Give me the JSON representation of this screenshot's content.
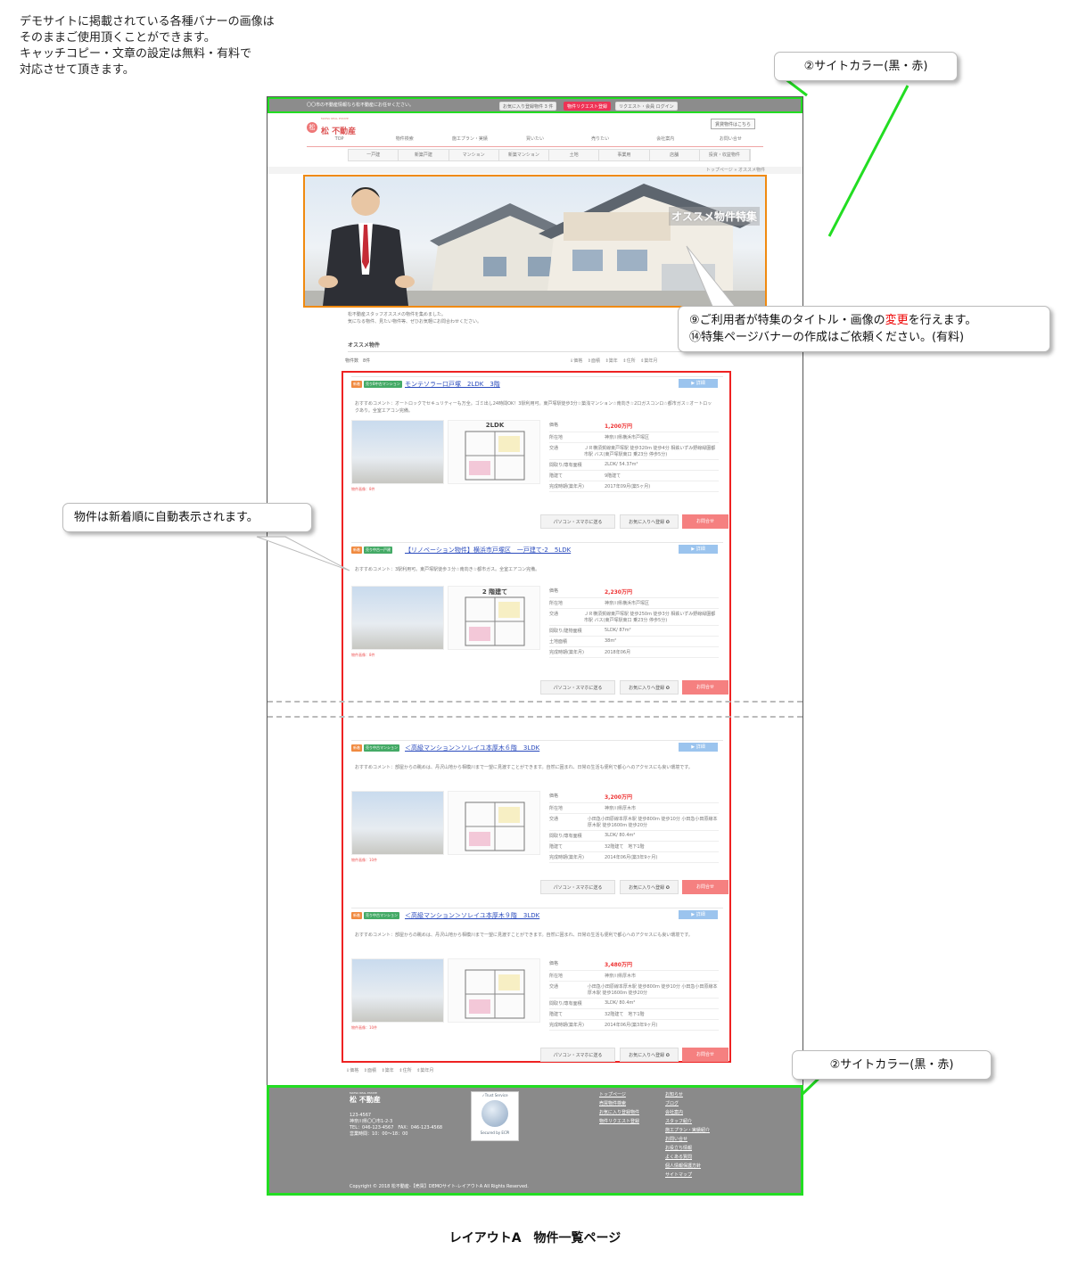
{
  "note_top": "デモサイトに掲載されている各種バナーの画像は\nそのままご使用頂くことができます。\nキャッチコピー・文章の設定は無料・有料で\n対応させて頂きます。",
  "caption": "レイアウトA　物件一覧ページ",
  "callouts": {
    "site_color_top": "②サイトカラー(黒・赤)",
    "site_color_bottom": "②サイトカラー(黒・赤)",
    "feature_line1_pre": "⑨ご利用者が特集のタイトル・画像の",
    "feature_line1_red": "変更",
    "feature_line1_post": "を行えます。",
    "feature_line2": "⑭特集ページバナーの作成はご依頼ください。(有料)",
    "listing_note": "物件は新着順に自動表示されます。"
  },
  "colors": {
    "site_green_frame": "#22dd22",
    "banner_frame": "#f08a10",
    "listing_frame": "#ee2222"
  },
  "site": {
    "tagline": "〇〇市の不動産情報なら松不動産にお任せください。",
    "topbar_buttons": [
      "お気に入り登録物件 3 件",
      "物件リクエスト登録",
      "リクエスト・会員 ログイン"
    ],
    "logo_sub": "MATSU REAL ESTATE",
    "logo_name": "松 不動産",
    "rent_button": "賃貸物件はこちら",
    "global_nav": [
      "TOP",
      "物件検索",
      "施工プラン・実績",
      "買いたい",
      "売りたい",
      "会社案内",
      "お問い合せ"
    ],
    "sub_nav": [
      "一戸建",
      "新築戸建",
      "マンション",
      "新築マンション",
      "土地",
      "事業用",
      "店舗",
      "投資・収益物件"
    ],
    "breadcrumb": "トップページ » オススメ物件",
    "hero_title": "オススメ物件特集",
    "intro": "松不動産スタッフオススメの物件を集めました。\n気になる物件、見たい物件等、ぜひお気軽にお問合わせください。",
    "section_title": "オススメ物件",
    "count": "物件数　8件",
    "sort": [
      "⇓価格",
      "⇕面積",
      "⇕築年",
      "⇕住所",
      "⇕築年月"
    ]
  },
  "listings": [
    {
      "badge_new": "新着",
      "badge_type": "売りB中古マンション",
      "title": "モンテソラー口戸塚　2LDK　3階",
      "detail": "▶ 詳細",
      "comment": "おすすめコメント：オートロックでセキュリティーも万全。ゴミ出し24時間OK！3駅利用可。東戸塚駅徒歩3分☆築浅マンション☆南向き☆2口ガスコンロ☆都市ガス☆オートロックあり。全室エアコン完備。",
      "floor_label": "2LDK",
      "photo_label": "物件画像：8件",
      "specs": [
        [
          "価格",
          "1,200万円"
        ],
        [
          "所在地",
          "神奈川県横浜市戸塚区"
        ],
        [
          "交通",
          "ＪＲ横須賀線東戸塚駅 徒歩320m 徒歩4分 相鉄いずみ野線緑園都市駅 バス(東戸塚駅東口 乗23分 停歩5分)"
        ],
        [
          "間取り/専有面積",
          "2LDK/ 54.37m²"
        ],
        [
          "階建て",
          "9階建て"
        ],
        [
          "完成時期(築年月)",
          "2017年09月(築5ヶ月)"
        ]
      ],
      "actions": [
        "パソコン・スマホに送る",
        "お気に入りへ登録 ✪",
        "お問合せ"
      ]
    },
    {
      "badge_new": "新着",
      "badge_type": "売り中古一戸建",
      "title": "【リノベーション物件】横浜市戸塚区　一戸建て-2　5LDK",
      "detail": "▶ 詳細",
      "comment": "おすすめコメント：3駅利用可。東戸塚駅徒歩３分☆南向き☆都市ガス。全室エアコン完備。",
      "floor_label": "2 階建て",
      "photo_label": "物件画像：8件",
      "specs": [
        [
          "価格",
          "2,230万円"
        ],
        [
          "所在地",
          "神奈川県横浜市戸塚区"
        ],
        [
          "交通",
          "ＪＲ横須賀線東戸塚駅 徒歩250m 徒歩3分 相鉄いずみ野線緑園都市駅 バス(東戸塚駅東口 乗23分 停歩5分)"
        ],
        [
          "間取り/建物面積",
          "5LDK/ 87m²"
        ],
        [
          "土地面積",
          "38m²"
        ],
        [
          "完成時期(築年月)",
          "2018年06月"
        ]
      ],
      "actions": [
        "パソコン・スマホに送る",
        "お気に入りへ登録 ✪",
        "お問合せ"
      ]
    },
    {
      "badge_new": "新着",
      "badge_type": "売り中古マンション",
      "title": "＜高級マンション＞ソレイユ本厚木６階　3LDK",
      "detail": "▶ 詳細",
      "comment": "おすすめコメント：部屋からの眺めは、丹沢山地から相模川まで一望に見渡すことができます。自然に囲まれ、日常の生活も便利で都心へのアクセスにも良い環境です。",
      "floor_label": "",
      "photo_label": "物件画像：10件",
      "specs": [
        [
          "価格",
          "3,200万円"
        ],
        [
          "所在地",
          "神奈川県厚木市"
        ],
        [
          "交通",
          "小田急小田原線本厚木駅 徒歩800m 徒歩10分 小田急小田原線本厚木駅 徒歩1600m 徒歩20分"
        ],
        [
          "間取り/専有面積",
          "3LDK/ 80.4m²"
        ],
        [
          "階建て",
          "32階建て　地下1階"
        ],
        [
          "完成時期(築年月)",
          "2014年06月(築3年9ヶ月)"
        ]
      ],
      "actions": [
        "パソコン・スマホに送る",
        "お気に入りへ登録 ✪",
        "お問合せ"
      ]
    },
    {
      "badge_new": "新着",
      "badge_type": "売り中古マンション",
      "title": "＜高級マンション＞ソレイユ本厚木９階　3LDK",
      "detail": "▶ 詳細",
      "comment": "おすすめコメント：部屋からの眺めは、丹沢山地から相模川まで一望に見渡すことができます。自然に囲まれ、日常の生活も便利で都心へのアクセスにも良い環境です。",
      "floor_label": "",
      "photo_label": "物件画像：10件",
      "specs": [
        [
          "価格",
          "3,480万円"
        ],
        [
          "所在地",
          "神奈川県厚木市"
        ],
        [
          "交通",
          "小田急小田原線本厚木駅 徒歩800m 徒歩10分 小田急小田原線本厚木駅 徒歩1600m 徒歩20分"
        ],
        [
          "間取り/専有面積",
          "3LDK/ 80.4m²"
        ],
        [
          "階建て",
          "32階建て　地下1階"
        ],
        [
          "完成時期(築年月)",
          "2014年06月(築3年9ヶ月)"
        ]
      ],
      "actions": [
        "パソコン・スマホに送る",
        "お気に入りへ登録 ✪",
        "お問合せ"
      ]
    }
  ],
  "footer": {
    "logo_sub": "MATSU REAL ESTATE",
    "logo_name": "松 不動産",
    "address": "123-4567\n神奈川県〇〇市1-2-3\nTEL：046-123-4567　FAX：046-123-4568\n営業時間：10：00～18：00",
    "trust_top": "✓Trust Service",
    "trust_bottom": "Secured by ECPI",
    "links_col1": [
      "トップページ",
      "売買物件検索",
      "お気に入り登録物件",
      "物件リクエスト登録"
    ],
    "links_col2": [
      "お知らせ",
      "ブログ",
      "会社案内",
      "スタッフ紹介",
      "施工プラン・実績紹介",
      "お問い合せ",
      "お役立ち情報",
      "よくある質問",
      "個人情報保護方針",
      "サイトマップ"
    ],
    "copyright": "Copyright © 2018 松不動産-【売買】DEMOサイト-レイアウトA All Rights Reserved."
  }
}
